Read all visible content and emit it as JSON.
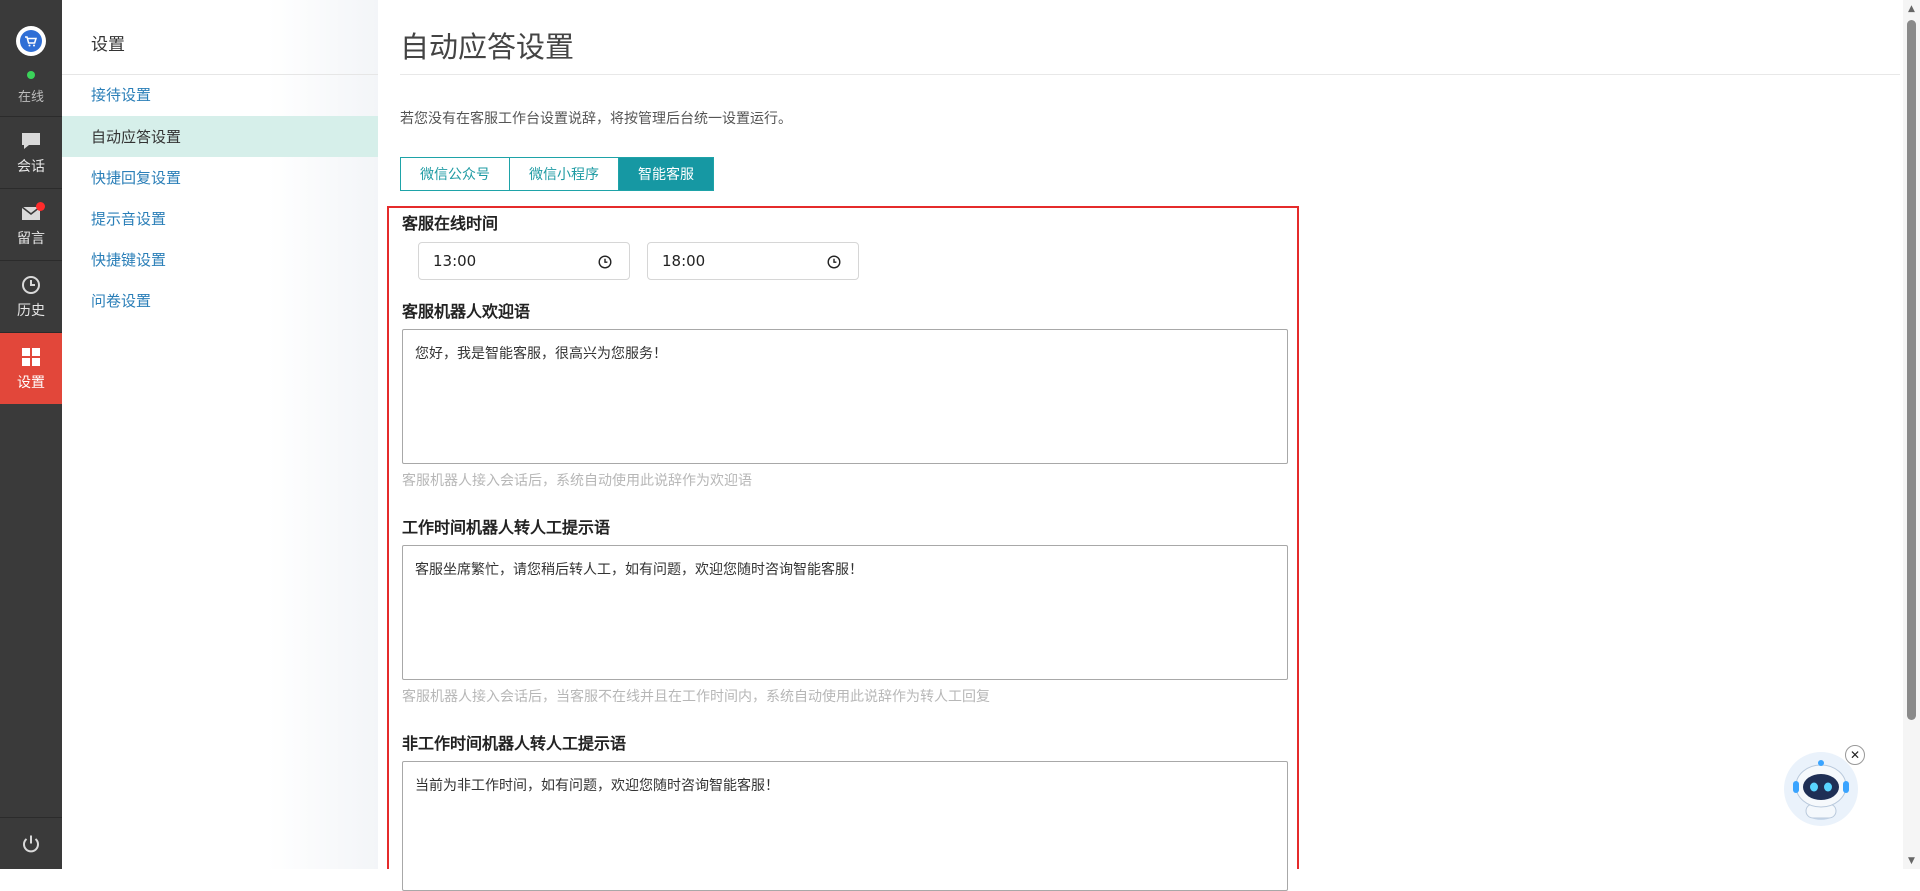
{
  "rail": {
    "status": "在线",
    "items": [
      {
        "label": "会话",
        "icon": "chat-icon"
      },
      {
        "label": "留言",
        "icon": "mail-icon"
      },
      {
        "label": "历史",
        "icon": "clock-icon"
      },
      {
        "label": "设置",
        "icon": "grid-icon"
      }
    ]
  },
  "sidebar": {
    "title": "设置",
    "items": [
      {
        "label": "接待设置"
      },
      {
        "label": "自动应答设置"
      },
      {
        "label": "快捷回复设置"
      },
      {
        "label": "提示音设置"
      },
      {
        "label": "快捷键设置"
      },
      {
        "label": "问卷设置"
      }
    ]
  },
  "main": {
    "title": "自动应答设置",
    "notice": "若您没有在客服工作台设置说辞，将按管理后台统一设置运行。",
    "tabs": [
      {
        "label": "微信公众号"
      },
      {
        "label": "微信小程序"
      },
      {
        "label": "智能客服"
      }
    ],
    "online_time": {
      "label": "客服在线时间",
      "start": "13:00",
      "end": "18:00"
    },
    "welcome": {
      "label": "客服机器人欢迎语",
      "value": "您好，我是智能客服，很高兴为您服务！",
      "help": "客服机器人接入会话后，系统自动使用此说辞作为欢迎语"
    },
    "work_transfer": {
      "label": "工作时间机器人转人工提示语",
      "value": "客服坐席繁忙，请您稍后转人工，如有问题，欢迎您随时咨询智能客服！",
      "help": "客服机器人接入会话后，当客服不在线并且在工作时间内，系统自动使用此说辞作为转人工回复"
    },
    "offwork_transfer": {
      "label": "非工作时间机器人转人工提示语",
      "value": "当前为非工作时间，如有问题，欢迎您随时咨询智能客服！"
    }
  },
  "colors": {
    "accent": "#1698a3",
    "rail_bg": "#3a3a3a",
    "active_rail": "#e2473a",
    "highlight_border": "#e52b2b"
  }
}
